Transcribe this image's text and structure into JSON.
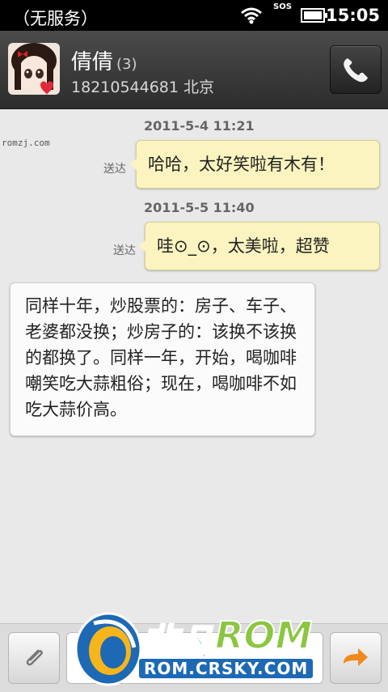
{
  "status_bar": {
    "carrier": "（无服务）",
    "time": "15:05",
    "sos": "SOS"
  },
  "contact": {
    "name": "倩倩",
    "count": "(3)",
    "phone": "18210544681",
    "location": "北京",
    "avatar_icon": "avatar-icon",
    "call_icon": "phone-icon"
  },
  "watermark": "romzj.com",
  "messages": [
    {
      "timestamp": "2011-5-4 11:21",
      "status": "送达",
      "text": "哈哈，太好笑啦有木有！"
    },
    {
      "timestamp": "2011-5-5 11:40",
      "status": "送达",
      "text": "哇⊙_⊙，太美啦，超赞"
    },
    {
      "text": "同样十年，炒股票的：房子、车子、老婆都没换；炒房子的：该换不该换的都换了。同样一年，开始，喝咖啡嘲笑吃大蒜粗俗；现在，喝咖啡不如吃大蒜价高。"
    }
  ],
  "compose": {
    "attach_icon": "paperclip-icon",
    "send_icon": "send-arrow-icon"
  },
  "overlay": {
    "brand_cn": "非凡",
    "brand_rom": "ROM",
    "url": "ROM.CRSKY.COM"
  },
  "colors": {
    "outgoing_bubble": "#fcf4c0",
    "incoming_bubble": "#fbfbfb",
    "header": "#3a3a3a",
    "background": "#e9e9ea"
  }
}
